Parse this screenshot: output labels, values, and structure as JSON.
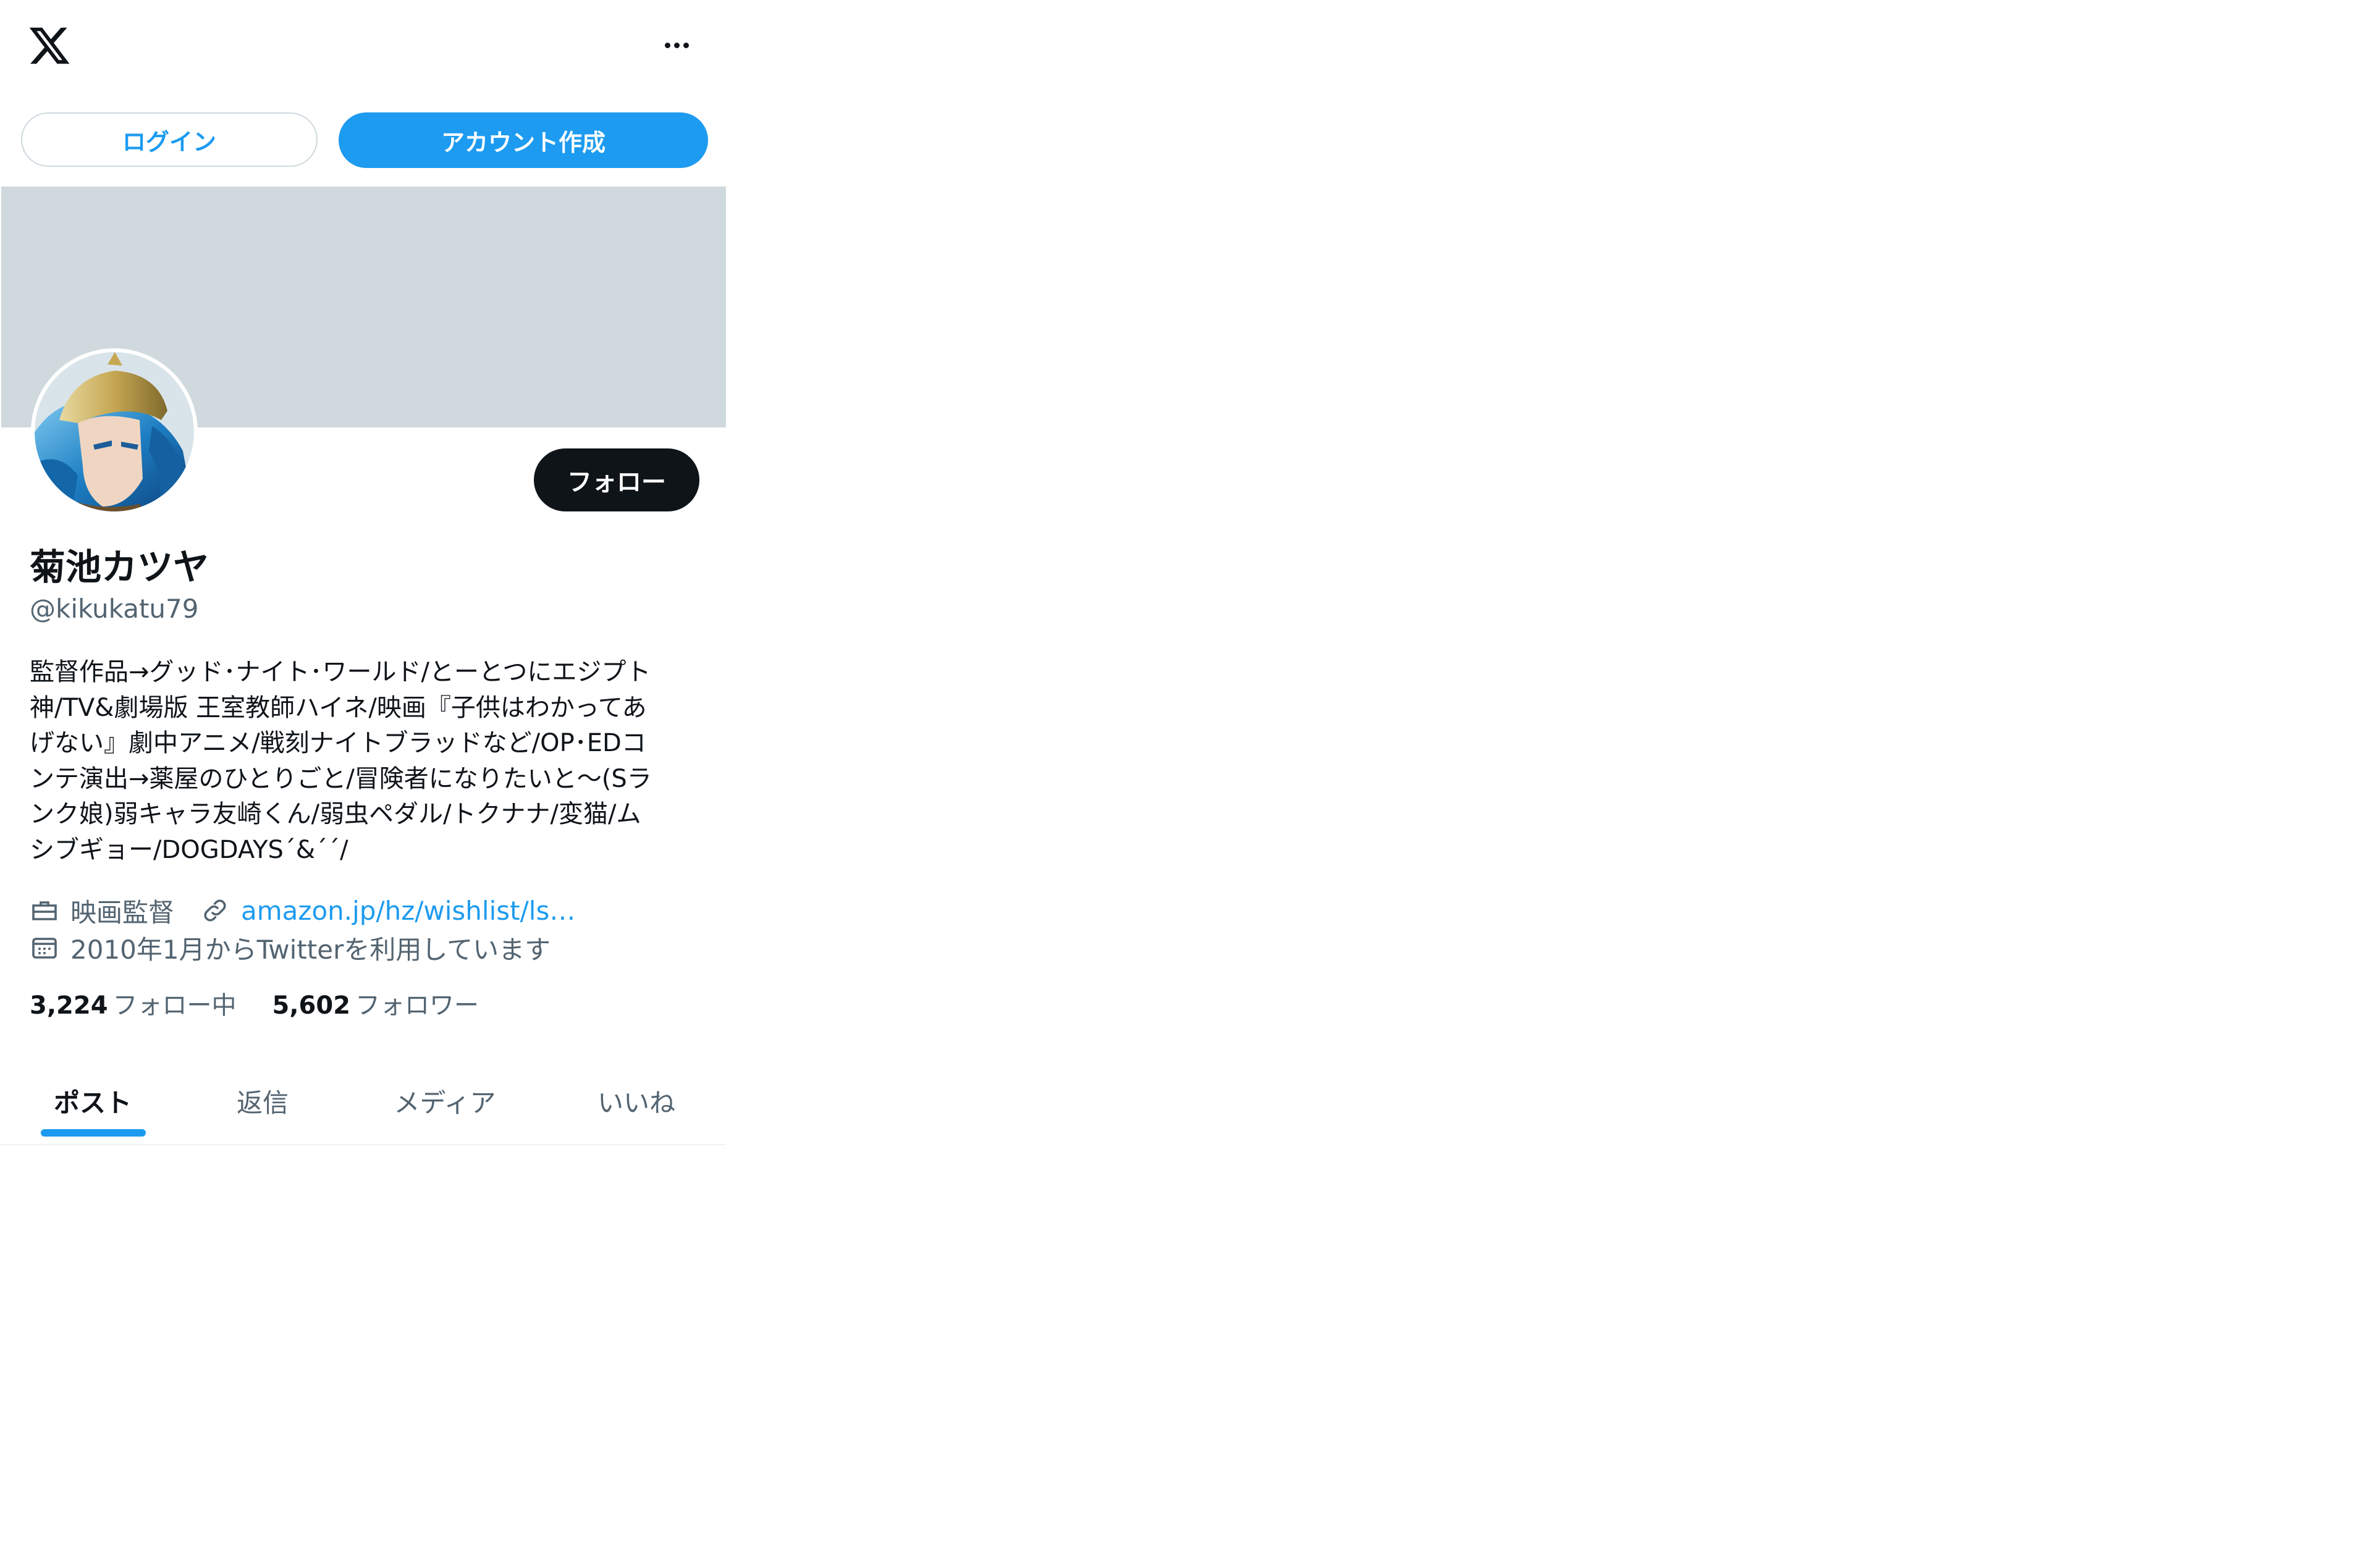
{
  "header": {
    "more_icon": "ellipsis-icon"
  },
  "auth": {
    "login_label": "ログイン",
    "signup_label": "アカウント作成"
  },
  "profile": {
    "follow_label": "フォロー",
    "display_name": "菊池カツヤ",
    "handle": "@kikukatu79",
    "bio": "監督作品→グッド･ナイト･ワールド/とーとつにエジプト\n神/TV&劇場版 王室教師ハイネ/映画『子供はわかってあ\nげない』劇中アニメ/戦刻ナイトブラッドなど/OP･EDコ\nンテ演出→薬屋のひとりごと/冒険者になりたいと〜(Sラ\nンク娘)弱キャラ友崎くん/弱虫ペダル/トクナナ/変猫/ム\nシブギョー/DOGDAYS´&´´/",
    "profession": "映画監督",
    "link_text": "amazon.jp/hz/wishlist/ls…",
    "joined": "2010年1月からTwitterを利用しています",
    "following_count": "3,224",
    "following_label": "フォロー中",
    "followers_count": "5,602",
    "followers_label": "フォロワー"
  },
  "tabs": [
    {
      "label": "ポスト",
      "active": true
    },
    {
      "label": "返信",
      "active": false
    },
    {
      "label": "メディア",
      "active": false
    },
    {
      "label": "いいね",
      "active": false
    }
  ],
  "colors": {
    "accent": "#1d9bf0",
    "text": "#0f1419",
    "secondary": "#536471",
    "banner": "#cfd9de"
  }
}
